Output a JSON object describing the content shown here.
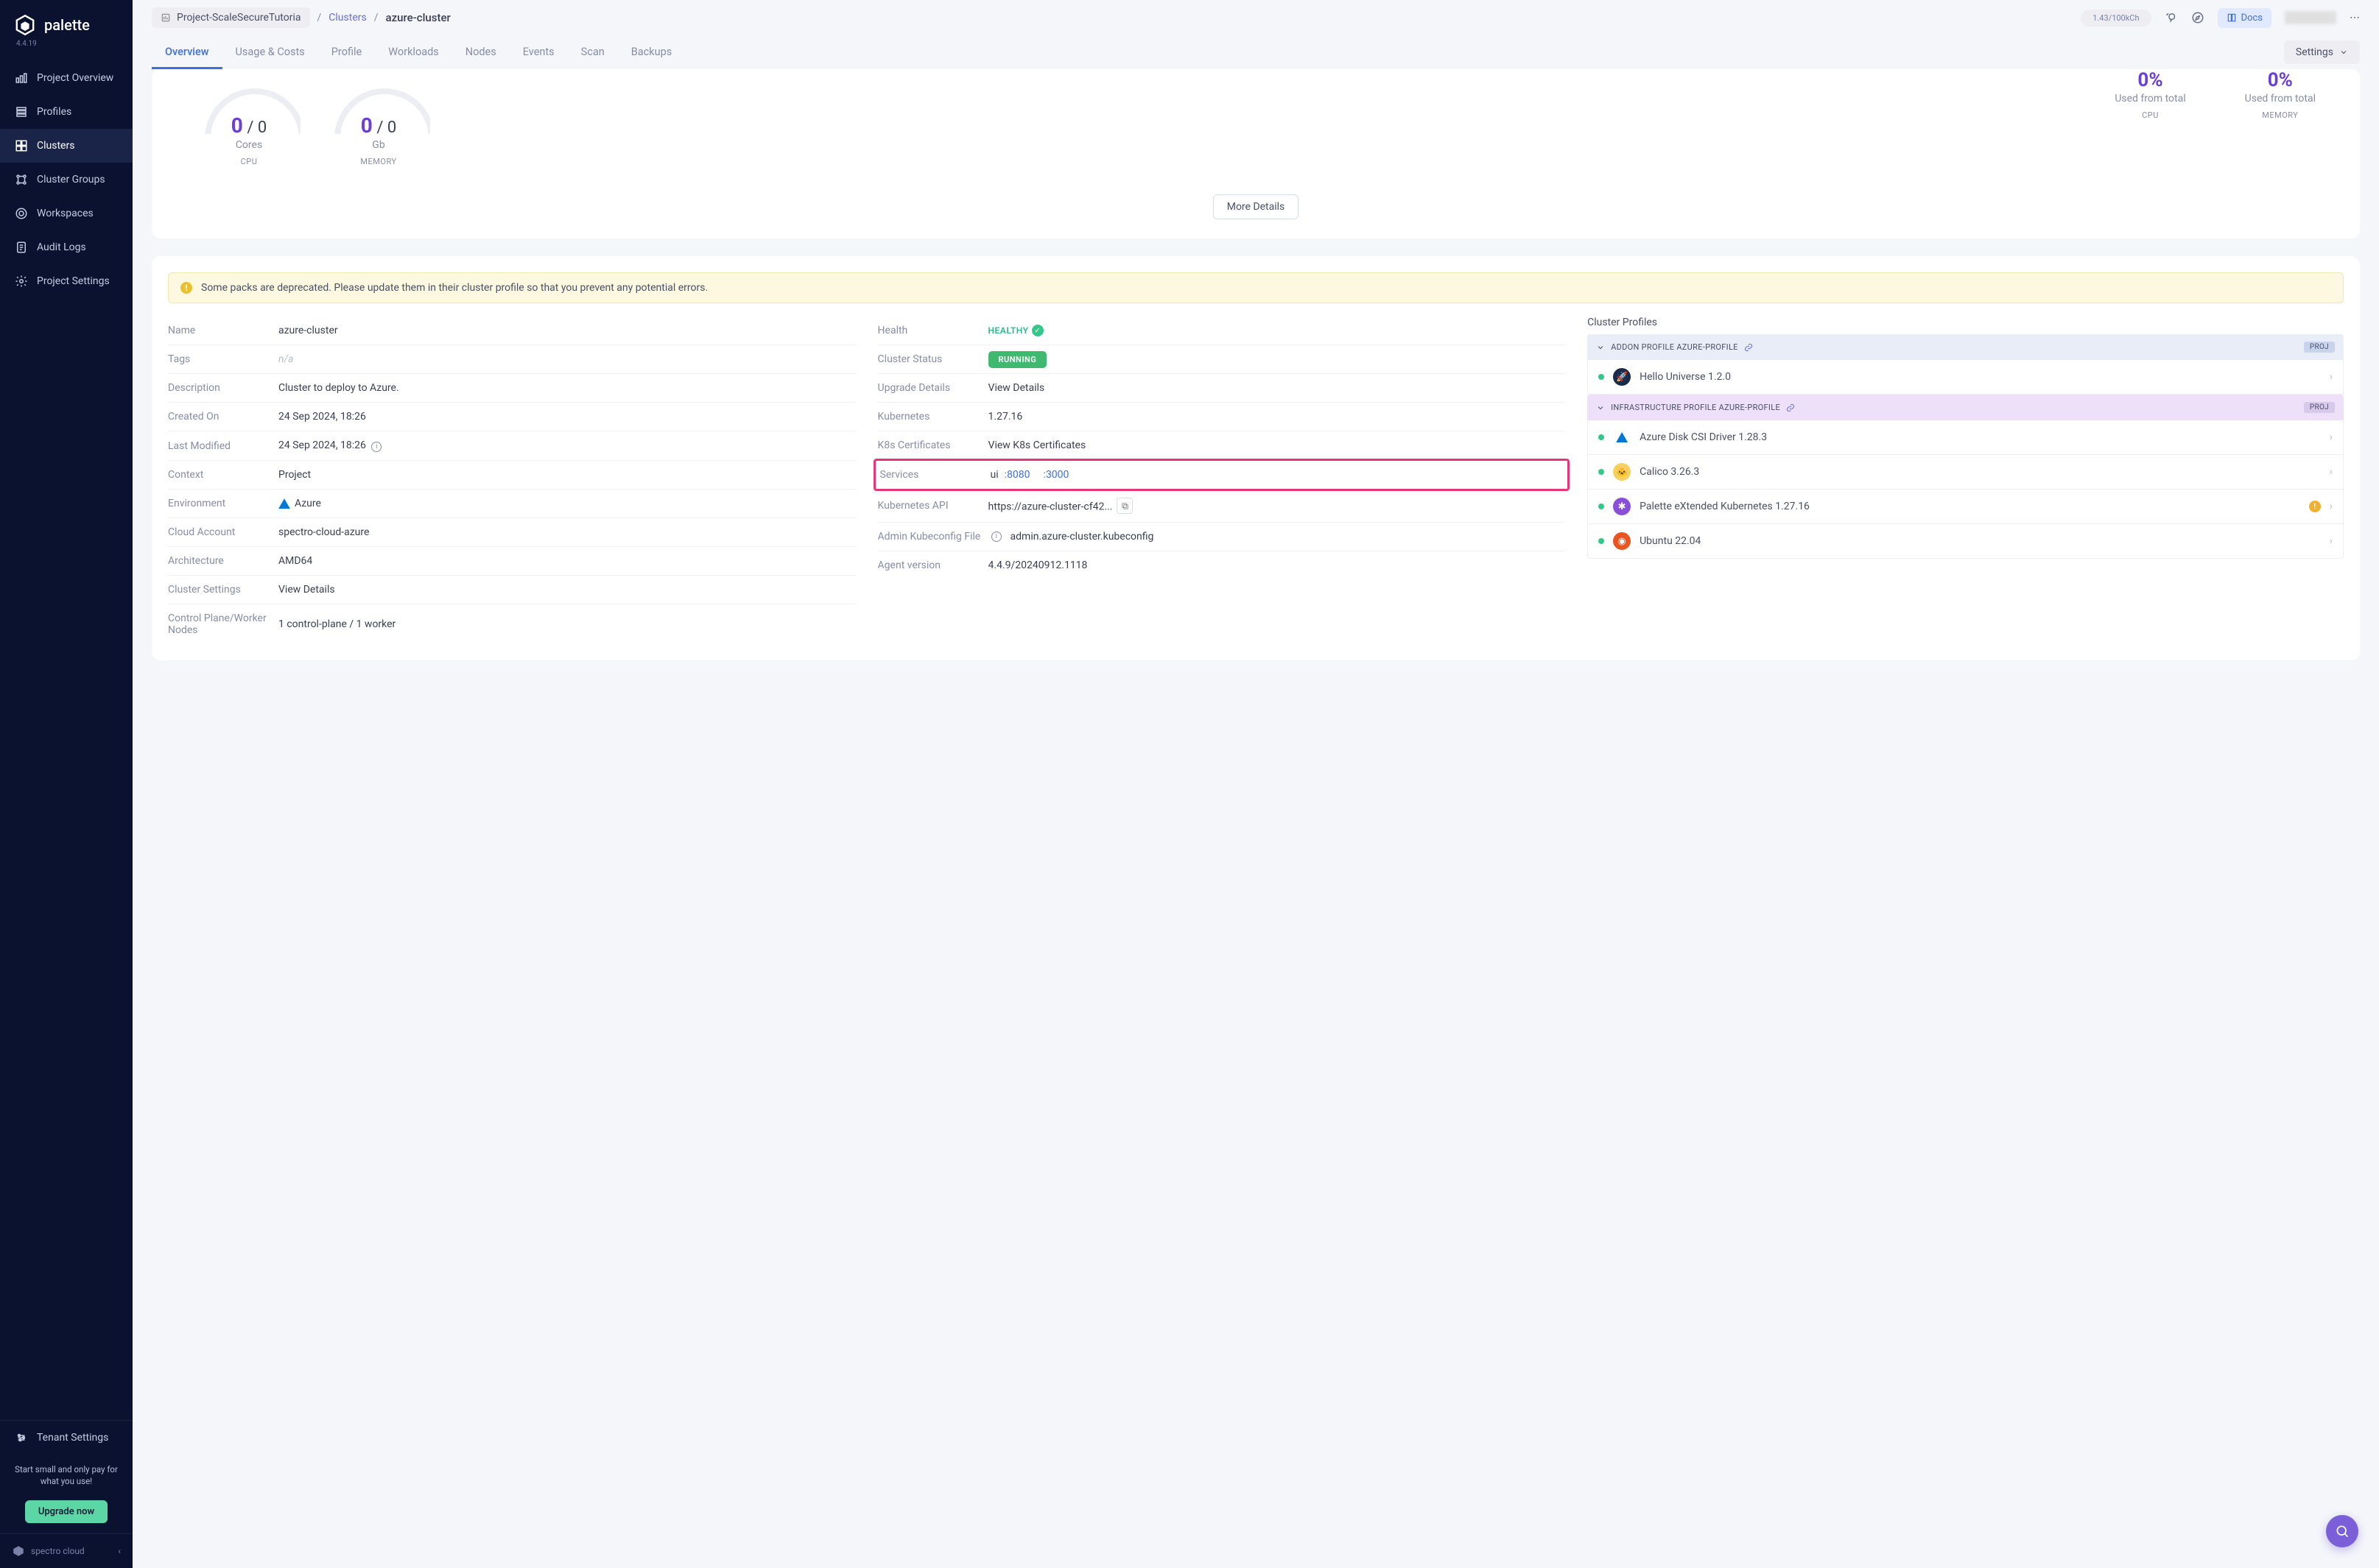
{
  "app": {
    "name": "palette",
    "version": "4.4.19"
  },
  "sidebar": {
    "items": [
      {
        "label": "Project Overview"
      },
      {
        "label": "Profiles"
      },
      {
        "label": "Clusters"
      },
      {
        "label": "Cluster Groups"
      },
      {
        "label": "Workspaces"
      },
      {
        "label": "Audit Logs"
      },
      {
        "label": "Project Settings"
      }
    ],
    "tenant_settings": "Tenant Settings",
    "promo": "Start small and only pay for what you use!",
    "upgrade": "Upgrade now",
    "brand": "spectro cloud"
  },
  "header": {
    "project": "Project-ScaleSecureTutoria",
    "crumb_sep": "/",
    "crumb_link": "Clusters",
    "cluster": "azure-cluster",
    "credits": "1.43/100kCh",
    "docs": "Docs",
    "tabs": [
      "Overview",
      "Usage & Costs",
      "Profile",
      "Workloads",
      "Nodes",
      "Events",
      "Scan",
      "Backups"
    ],
    "settings": "Settings"
  },
  "metrics": {
    "cpu_val": "0",
    "cpu_total": " / 0",
    "cpu_unit": "Cores",
    "cpu_type": "CPU",
    "mem_val": "0",
    "mem_total": " / 0",
    "mem_unit": "Gb",
    "mem_type": "MEMORY",
    "pct_cpu": "0%",
    "pct_mem": "0%",
    "used_label": "Used from total",
    "more": "More Details"
  },
  "alert": "Some packs are deprecated. Please update them in their cluster profile so that you prevent any potential errors.",
  "details": {
    "left": {
      "name_k": "Name",
      "name_v": "azure-cluster",
      "tags_k": "Tags",
      "tags_v": "n/a",
      "desc_k": "Description",
      "desc_v": "Cluster to deploy to Azure.",
      "created_k": "Created On",
      "created_v": "24 Sep 2024, 18:26",
      "mod_k": "Last Modified",
      "mod_v": "24 Sep 2024, 18:26",
      "ctx_k": "Context",
      "ctx_v": "Project",
      "env_k": "Environment",
      "env_v": "Azure",
      "acct_k": "Cloud Account",
      "acct_v": "spectro-cloud-azure",
      "arch_k": "Architecture",
      "arch_v": "AMD64",
      "cs_k": "Cluster Settings",
      "cs_v": "View Details",
      "nodes_k": "Control Plane/Worker Nodes",
      "nodes_v": "1 control-plane / 1 worker"
    },
    "right": {
      "health_k": "Health",
      "health_v": "HEALTHY",
      "status_k": "Cluster Status",
      "status_v": "RUNNING",
      "upg_k": "Upgrade Details",
      "upg_v": "View Details",
      "k8s_k": "Kubernetes",
      "k8s_v": "1.27.16",
      "certs_k": "K8s Certificates",
      "certs_v": "View K8s Certificates",
      "svc_k": "Services",
      "svc_name": "ui",
      "svc_p1": ":8080",
      "svc_p2": ":3000",
      "api_k": "Kubernetes API",
      "api_v": "https://azure-cluster-cf42...",
      "kube_k": "Admin Kubeconfig File",
      "kube_v": "admin.azure-cluster.kubeconfig",
      "agent_k": "Agent version",
      "agent_v": "4.4.9/20240912.1118"
    }
  },
  "profiles": {
    "title": "Cluster Profiles",
    "addon_header": "ADDON PROFILE AZURE-PROFILE",
    "proj_badge": "PROJ",
    "infra_header": "INFRASTRUCTURE PROFILE AZURE-PROFILE",
    "packs": [
      {
        "name": "Hello Universe 1.2.0"
      },
      {
        "name": "Azure Disk CSI Driver 1.28.3"
      },
      {
        "name": "Calico 3.26.3"
      },
      {
        "name": "Palette eXtended Kubernetes 1.27.16"
      },
      {
        "name": "Ubuntu 22.04"
      }
    ]
  }
}
